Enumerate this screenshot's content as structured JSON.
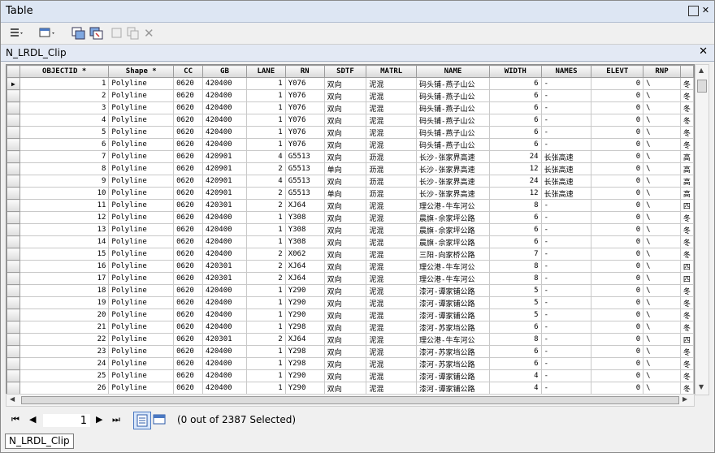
{
  "window": {
    "title": "Table"
  },
  "tab": {
    "name": "N_LRDL_Clip"
  },
  "columns": [
    "OBJECTID *",
    "Shape *",
    "CC",
    "GB",
    "LANE",
    "RN",
    "SDTF",
    "MATRL",
    "NAME",
    "WIDTH",
    "NAMES",
    "ELEVT",
    "RNP",
    ""
  ],
  "rows": [
    [
      "1",
      "Polyline",
      "0620",
      "420400",
      "1",
      "Y076",
      "双向",
      "泥混",
      "码头铺-燕子山公",
      "6",
      "-",
      "0",
      "\\",
      "冬"
    ],
    [
      "2",
      "Polyline",
      "0620",
      "420400",
      "1",
      "Y076",
      "双向",
      "泥混",
      "码头铺-燕子山公",
      "6",
      "-",
      "0",
      "\\",
      "冬"
    ],
    [
      "3",
      "Polyline",
      "0620",
      "420400",
      "1",
      "Y076",
      "双向",
      "泥混",
      "码头铺-燕子山公",
      "6",
      "-",
      "0",
      "\\",
      "冬"
    ],
    [
      "4",
      "Polyline",
      "0620",
      "420400",
      "1",
      "Y076",
      "双向",
      "泥混",
      "码头铺-燕子山公",
      "6",
      "-",
      "0",
      "\\",
      "冬"
    ],
    [
      "5",
      "Polyline",
      "0620",
      "420400",
      "1",
      "Y076",
      "双向",
      "泥混",
      "码头铺-燕子山公",
      "6",
      "-",
      "0",
      "\\",
      "冬"
    ],
    [
      "6",
      "Polyline",
      "0620",
      "420400",
      "1",
      "Y076",
      "双向",
      "泥混",
      "码头铺-燕子山公",
      "6",
      "-",
      "0",
      "\\",
      "冬"
    ],
    [
      "7",
      "Polyline",
      "0620",
      "420901",
      "4",
      "G5513",
      "双向",
      "沥混",
      "长沙-张家界高速",
      "24",
      "长张高速",
      "0",
      "\\",
      "高"
    ],
    [
      "8",
      "Polyline",
      "0620",
      "420901",
      "2",
      "G5513",
      "单向",
      "沥混",
      "长沙-张家界高速",
      "12",
      "长张高速",
      "0",
      "\\",
      "高"
    ],
    [
      "9",
      "Polyline",
      "0620",
      "420901",
      "4",
      "G5513",
      "双向",
      "沥混",
      "长沙-张家界高速",
      "24",
      "长张高速",
      "0",
      "\\",
      "高"
    ],
    [
      "10",
      "Polyline",
      "0620",
      "420901",
      "2",
      "G5513",
      "单向",
      "沥混",
      "长沙-张家界高速",
      "12",
      "长张高速",
      "0",
      "\\",
      "高"
    ],
    [
      "11",
      "Polyline",
      "0620",
      "420301",
      "2",
      "XJ64",
      "双向",
      "泥混",
      "理公港-牛车河公",
      "8",
      "-",
      "0",
      "\\",
      "四"
    ],
    [
      "12",
      "Polyline",
      "0620",
      "420400",
      "1",
      "Y308",
      "双向",
      "泥混",
      "晨旗-佘家坪公路",
      "6",
      "-",
      "0",
      "\\",
      "冬"
    ],
    [
      "13",
      "Polyline",
      "0620",
      "420400",
      "1",
      "Y308",
      "双向",
      "泥混",
      "晨旗-佘家坪公路",
      "6",
      "-",
      "0",
      "\\",
      "冬"
    ],
    [
      "14",
      "Polyline",
      "0620",
      "420400",
      "1",
      "Y308",
      "双向",
      "泥混",
      "晨旗-佘家坪公路",
      "6",
      "-",
      "0",
      "\\",
      "冬"
    ],
    [
      "15",
      "Polyline",
      "0620",
      "420400",
      "2",
      "X062",
      "双向",
      "泥混",
      "三阳-向家桥公路",
      "7",
      "-",
      "0",
      "\\",
      "冬"
    ],
    [
      "16",
      "Polyline",
      "0620",
      "420301",
      "2",
      "XJ64",
      "双向",
      "泥混",
      "理公港-牛车河公",
      "8",
      "-",
      "0",
      "\\",
      "四"
    ],
    [
      "17",
      "Polyline",
      "0620",
      "420301",
      "2",
      "XJ64",
      "双向",
      "泥混",
      "理公港-牛车河公",
      "8",
      "-",
      "0",
      "\\",
      "四"
    ],
    [
      "18",
      "Polyline",
      "0620",
      "420400",
      "1",
      "Y290",
      "双向",
      "泥混",
      "漆河-谭家铺公路",
      "5",
      "-",
      "0",
      "\\",
      "冬"
    ],
    [
      "19",
      "Polyline",
      "0620",
      "420400",
      "1",
      "Y290",
      "双向",
      "泥混",
      "漆河-谭家铺公路",
      "5",
      "-",
      "0",
      "\\",
      "冬"
    ],
    [
      "20",
      "Polyline",
      "0620",
      "420400",
      "1",
      "Y290",
      "双向",
      "泥混",
      "漆河-谭家铺公路",
      "5",
      "-",
      "0",
      "\\",
      "冬"
    ],
    [
      "21",
      "Polyline",
      "0620",
      "420400",
      "1",
      "Y298",
      "双向",
      "泥混",
      "漆河-苏家垱公路",
      "6",
      "-",
      "0",
      "\\",
      "冬"
    ],
    [
      "22",
      "Polyline",
      "0620",
      "420301",
      "2",
      "XJ64",
      "双向",
      "泥混",
      "理公港-牛车河公",
      "8",
      "-",
      "0",
      "\\",
      "四"
    ],
    [
      "23",
      "Polyline",
      "0620",
      "420400",
      "1",
      "Y298",
      "双向",
      "泥混",
      "漆河-苏家垱公路",
      "6",
      "-",
      "0",
      "\\",
      "冬"
    ],
    [
      "24",
      "Polyline",
      "0620",
      "420400",
      "1",
      "Y298",
      "双向",
      "泥混",
      "漆河-苏家垱公路",
      "6",
      "-",
      "0",
      "\\",
      "冬"
    ],
    [
      "25",
      "Polyline",
      "0620",
      "420400",
      "1",
      "Y290",
      "双向",
      "泥混",
      "漆河-谭家铺公路",
      "4",
      "-",
      "0",
      "\\",
      "冬"
    ],
    [
      "26",
      "Polyline",
      "0620",
      "420400",
      "1",
      "Y290",
      "双向",
      "泥混",
      "漆河-谭家铺公路",
      "4",
      "-",
      "0",
      "\\",
      "冬"
    ]
  ],
  "navigator": {
    "current_record": "1",
    "selection_text": "(0 out of 2387 Selected)"
  },
  "bottom_tab": {
    "label": "N_LRDL_Clip"
  },
  "icons": {
    "row_pointer": "▶",
    "first": "⏮",
    "prev": "◀",
    "next": "▶",
    "last": "⏭",
    "close": "✕",
    "restore": "▢"
  }
}
